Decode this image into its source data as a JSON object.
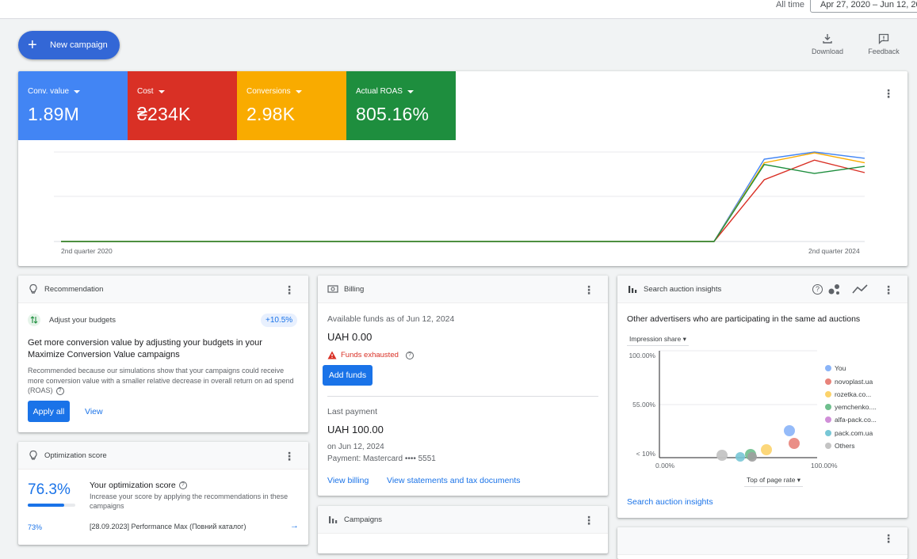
{
  "header": {
    "range_label": "All time",
    "date_range": "Apr 27, 2020 – Jun 12, 2024"
  },
  "toolbar": {
    "new_campaign": "New campaign",
    "download": "Download",
    "feedback": "Feedback"
  },
  "overview": {
    "metrics": [
      {
        "label": "Conv. value",
        "value": "1.89M",
        "color": "#4285f4"
      },
      {
        "label": "Cost",
        "value": "₴234K",
        "color": "#d93025"
      },
      {
        "label": "Conversions",
        "value": "2.98K",
        "color": "#f9ab00"
      },
      {
        "label": "Actual ROAS",
        "value": "805.16%",
        "color": "#1e8e3e"
      }
    ],
    "x_start": "2nd quarter 2020",
    "x_end": "2nd quarter 2024"
  },
  "chart_data": {
    "type": "line",
    "x": [
      "2nd quarter 2020",
      "",
      "",
      "",
      "",
      "",
      "",
      "",
      "",
      "",
      "",
      "",
      "",
      "",
      "",
      "",
      "2nd quarter 2024"
    ],
    "series": [
      {
        "values": [
          0,
          0,
          0,
          0,
          0,
          0,
          0,
          0,
          0,
          0,
          0,
          0,
          0,
          0,
          0.92,
          1.0,
          0.93
        ],
        "color": "#4285f4"
      },
      {
        "values": [
          0,
          0,
          0,
          0,
          0,
          0,
          0,
          0,
          0,
          0,
          0,
          0,
          0,
          0,
          0.69,
          0.91,
          0.77
        ],
        "color": "#d93025"
      },
      {
        "values": [
          0,
          0,
          0,
          0,
          0,
          0,
          0,
          0,
          0,
          0,
          0,
          0,
          0,
          0,
          0.88,
          0.99,
          0.88
        ],
        "color": "#f9ab00"
      },
      {
        "values": [
          0,
          0,
          0,
          0,
          0,
          0,
          0,
          0,
          0,
          0,
          0,
          0,
          0,
          0,
          0.86,
          0.76,
          0.84
        ],
        "color": "#1e8e3e"
      }
    ]
  },
  "recommendation": {
    "title": "Recommendation",
    "item": "Adjust your budgets",
    "uplift": "+10.5%",
    "headline": "Get more conversion value by adjusting your budgets in your Maximize Conversion Value campaigns",
    "body": "Recommended because our simulations show that your campaigns could receive more conversion value with a smaller relative decrease in overall return on ad spend (ROAS)",
    "apply": "Apply all",
    "view": "View"
  },
  "optimization": {
    "title": "Optimization score",
    "score": "76.3%",
    "score_fraction": 0.763,
    "heading": "Your optimization score",
    "desc": "Increase your score by applying the recommendations in these campaigns",
    "row_pct": "73%",
    "row_name": "[28.09.2023] Performance Max (Повний каталог)"
  },
  "billing": {
    "title": "Billing",
    "available_label": "Available funds as of Jun 12, 2024",
    "available_amount": "UAH 0.00",
    "warning": "Funds exhausted",
    "add_funds": "Add funds",
    "last_label": "Last payment",
    "last_amount": "UAH 100.00",
    "last_date": "on Jun 12, 2024",
    "payment_method": "Payment: Mastercard •••• 5551",
    "view_billing": "View billing",
    "view_statements": "View statements and tax documents"
  },
  "campaigns": {
    "title": "Campaigns"
  },
  "auction": {
    "title": "Search auction insights",
    "subtitle": "Other advertisers who are participating in the same ad auctions",
    "y_metric": "Impression share",
    "x_metric": "Top of page rate",
    "y_ticks": [
      "100.00%",
      "55.00%",
      "< 10%"
    ],
    "x_ticks": [
      "0.00%",
      "100.00%"
    ],
    "link": "Search auction insights",
    "legend": [
      {
        "name": "You",
        "color": "#8ab4f8"
      },
      {
        "name": "novoplast.ua",
        "color": "#e8837a"
      },
      {
        "name": "rozetka.co...",
        "color": "#fcd36b"
      },
      {
        "name": "yemchenko....",
        "color": "#6fbf8e"
      },
      {
        "name": "alfa-pack.co...",
        "color": "#d08fd8"
      },
      {
        "name": "pack.com.ua",
        "color": "#78c7d6"
      },
      {
        "name": "Others",
        "color": "#c4c4c4"
      }
    ]
  }
}
